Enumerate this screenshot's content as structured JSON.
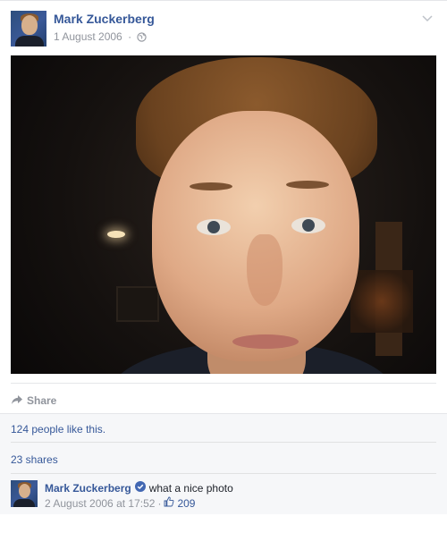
{
  "post": {
    "author": "Mark Zuckerberg",
    "date": "1 August 2006",
    "separator": "·",
    "audience_icon": "globe-icon"
  },
  "actions": {
    "share_label": "Share"
  },
  "stats": {
    "likes_text": "124 people like this.",
    "shares_text": "23 shares"
  },
  "comment": {
    "author": "Mark Zuckerberg",
    "verified_icon": "verified-badge-icon",
    "text": "what a nice photo",
    "timestamp": "2 August 2006 at 17:52",
    "separator": "·",
    "likes": "209",
    "like_icon": "thumbs-up-icon"
  },
  "colors": {
    "link": "#365899",
    "meta": "#90949c",
    "footer_bg": "#f6f7f9",
    "verified": "#4267b2"
  }
}
